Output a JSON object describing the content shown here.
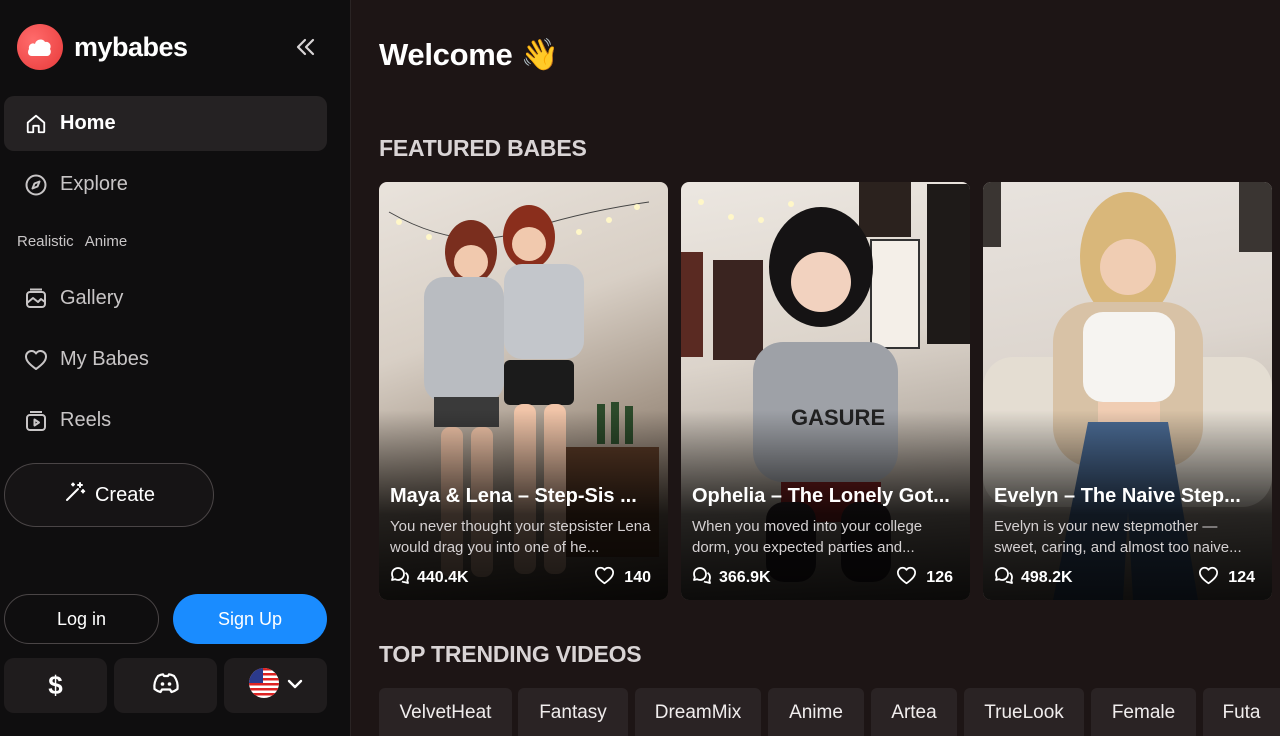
{
  "brand": {
    "name": "mybabes",
    "accent": "#e83a3a"
  },
  "sidebar": {
    "nav": [
      {
        "label": "Home",
        "icon": "home-icon",
        "active": true
      },
      {
        "label": "Explore",
        "icon": "compass-icon"
      },
      {
        "label": "Gallery",
        "icon": "gallery-icon"
      },
      {
        "label": "My Babes",
        "icon": "heart-icon"
      },
      {
        "label": "Reels",
        "icon": "reels-icon"
      }
    ],
    "subtabs": [
      "Realistic",
      "Anime"
    ],
    "create_label": "Create",
    "login_label": "Log in",
    "signup_label": "Sign Up",
    "signup_color": "#1a8cff",
    "utility": {
      "currency": "$",
      "discord": "discord-icon",
      "language": "us-flag-icon"
    }
  },
  "main": {
    "welcome": "Welcome 👋",
    "featured_title": "FEATURED BABES",
    "cards": [
      {
        "title": "Maya & Lena – Step-Sis ...",
        "desc": "You never thought your stepsister Lena would drag you into one of he...",
        "chats": "440.4K",
        "likes": "140"
      },
      {
        "title": "Ophelia – The Lonely Got...",
        "desc": "When you moved into your college dorm, you expected parties and...",
        "chats": "366.9K",
        "likes": "126"
      },
      {
        "title": "Evelyn – The Naive Step...",
        "desc": "Evelyn is your new stepmother — sweet, caring, and almost too naive...",
        "chats": "498.2K",
        "likes": "124"
      }
    ],
    "trending_title": "TOP TRENDING VIDEOS",
    "tags": [
      "VelvetHeat",
      "Fantasy",
      "DreamMix",
      "Anime",
      "Artea",
      "TrueLook",
      "Female",
      "Futa"
    ]
  }
}
